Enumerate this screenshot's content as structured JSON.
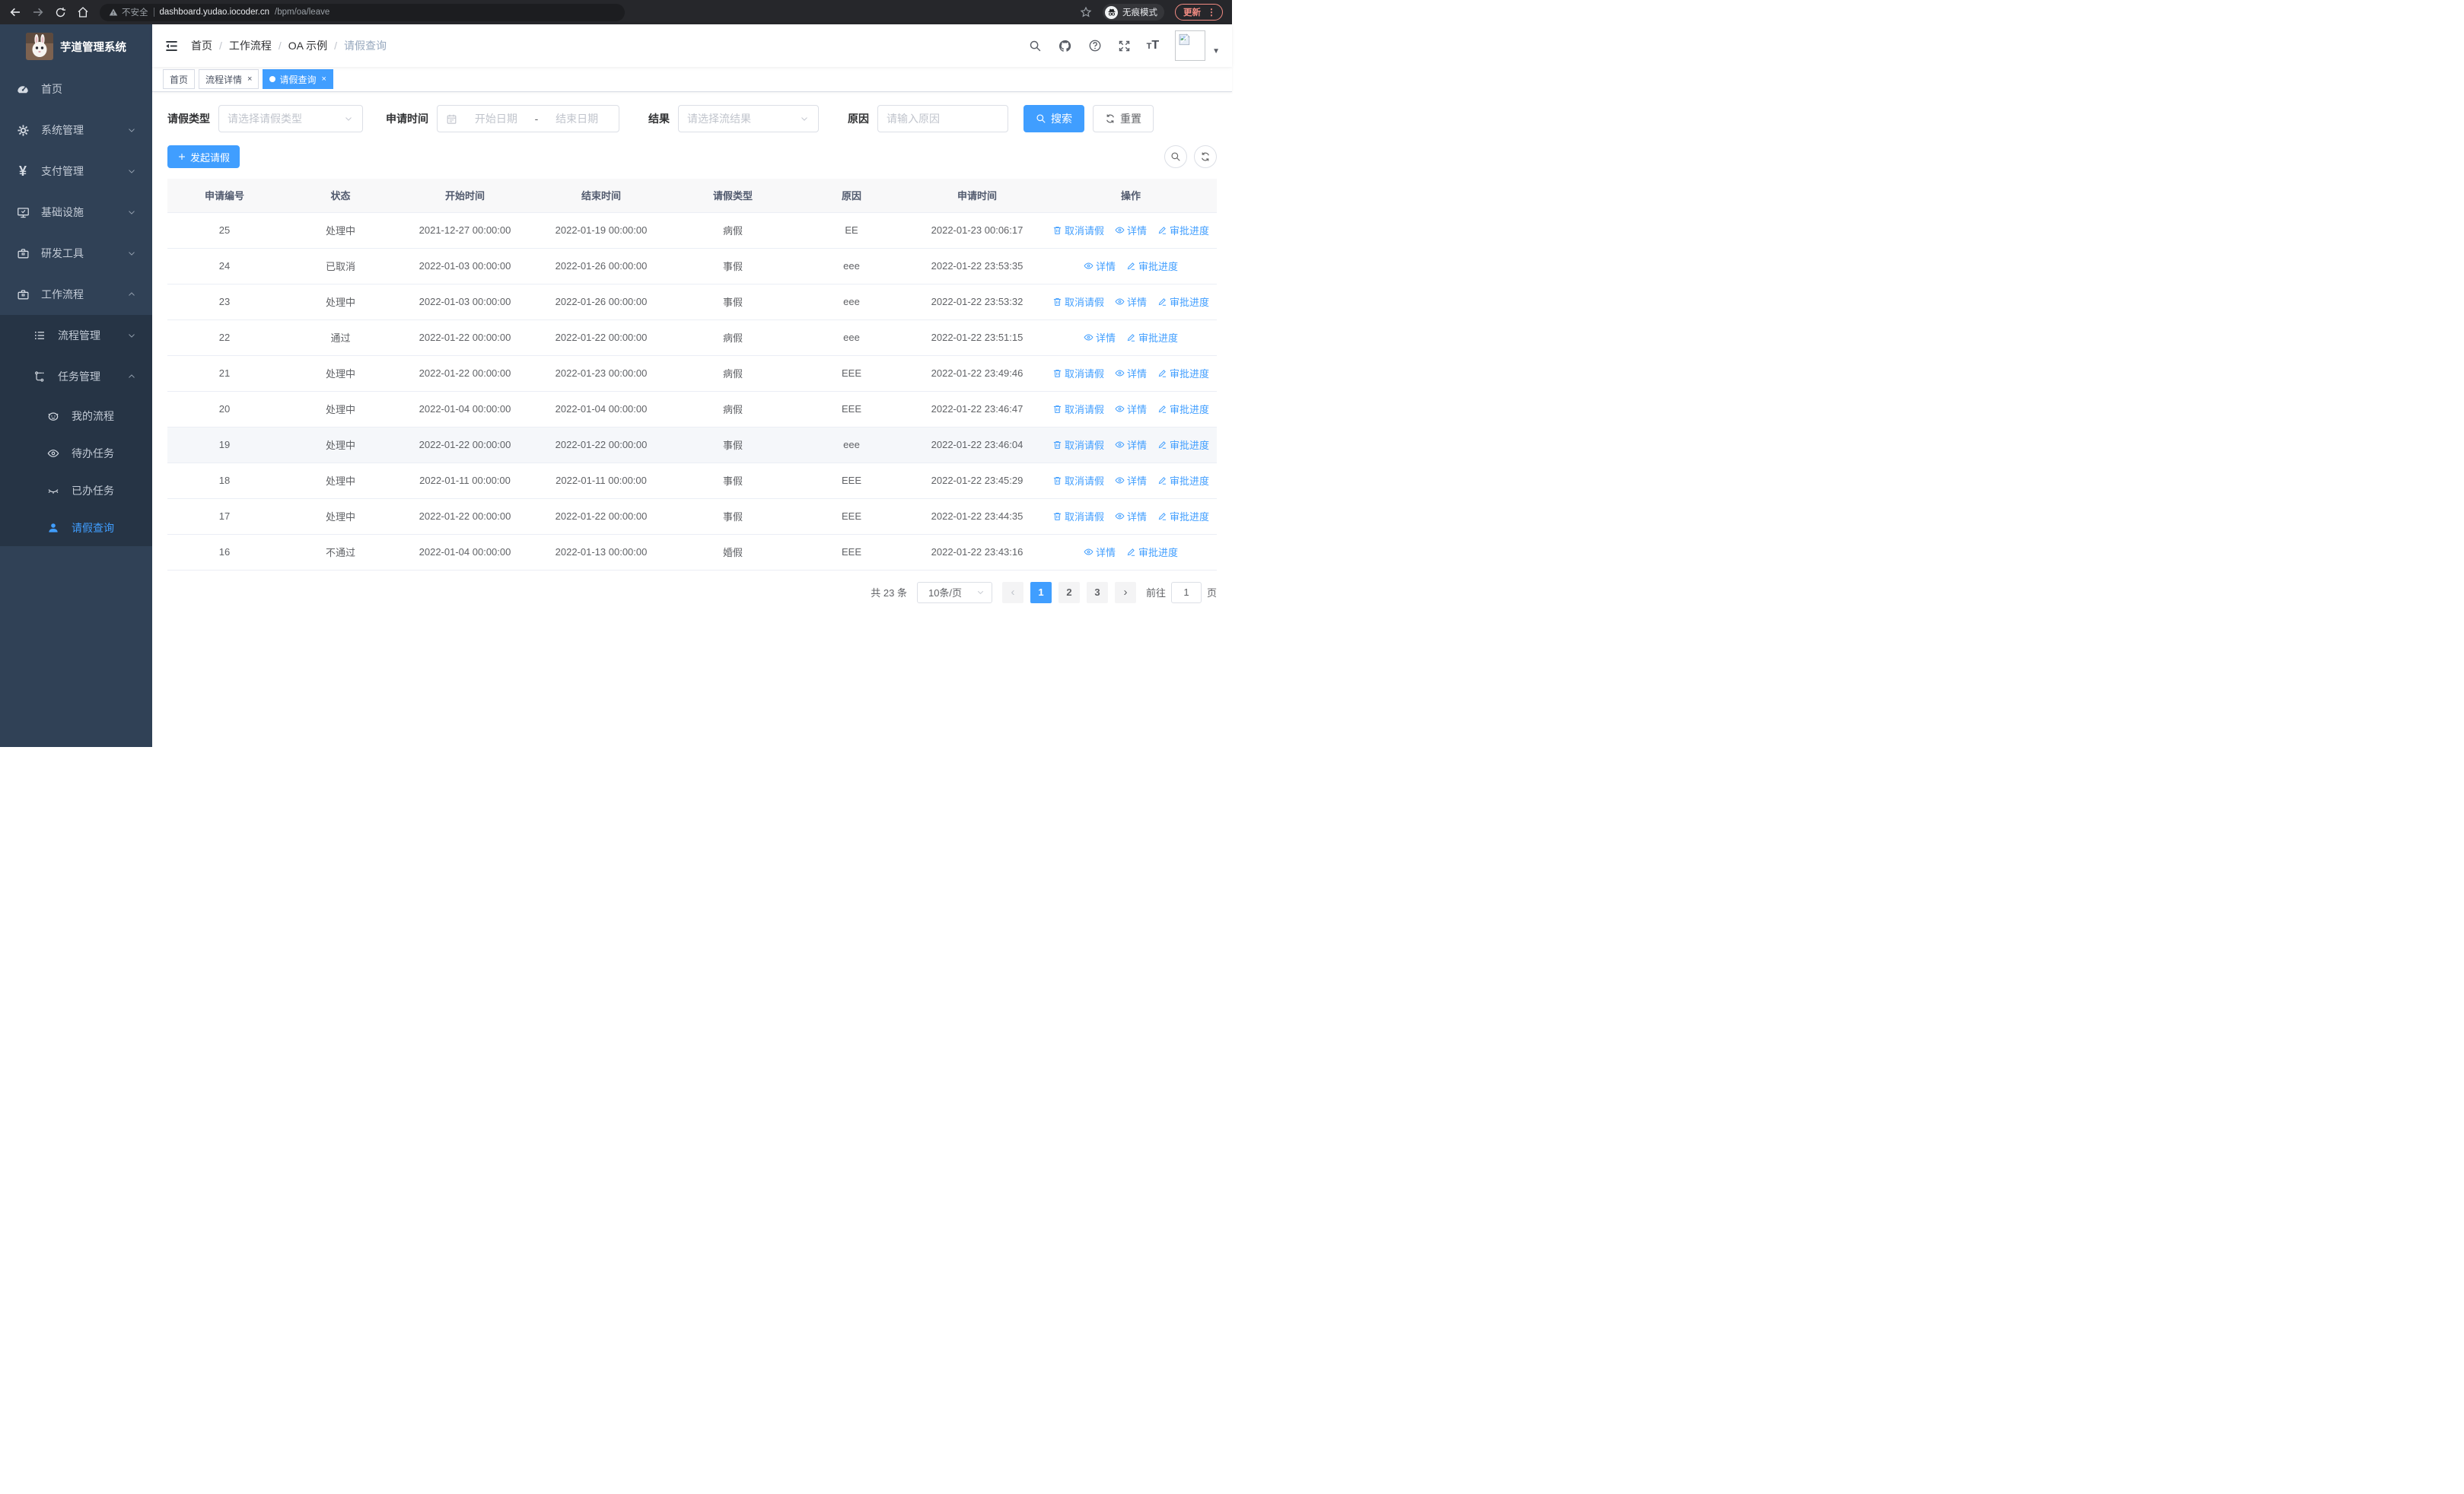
{
  "browser": {
    "security_label": "不安全",
    "url_host": "dashboard.yudao.iocoder.cn",
    "url_path": "/bpm/oa/leave",
    "incognito_label": "无痕模式",
    "update_label": "更新"
  },
  "sidebar": {
    "title": "芋道管理系统",
    "items": [
      {
        "label": "首页"
      },
      {
        "label": "系统管理"
      },
      {
        "label": "支付管理"
      },
      {
        "label": "基础设施"
      },
      {
        "label": "研发工具"
      },
      {
        "label": "工作流程"
      },
      {
        "label": "流程管理"
      },
      {
        "label": "任务管理"
      },
      {
        "label": "我的流程"
      },
      {
        "label": "待办任务"
      },
      {
        "label": "已办任务"
      },
      {
        "label": "请假查询"
      }
    ]
  },
  "breadcrumb": [
    "首页",
    "工作流程",
    "OA 示例",
    "请假查询"
  ],
  "tabs": [
    {
      "label": "首页"
    },
    {
      "label": "流程详情"
    },
    {
      "label": "请假查询"
    }
  ],
  "filters": {
    "leave_type_label": "请假类型",
    "leave_type_placeholder": "请选择请假类型",
    "apply_time_label": "申请时间",
    "date_start_placeholder": "开始日期",
    "date_separator": "-",
    "date_end_placeholder": "结束日期",
    "result_label": "结果",
    "result_placeholder": "请选择流结果",
    "reason_label": "原因",
    "reason_placeholder": "请输入原因",
    "search_label": "搜索",
    "reset_label": "重置"
  },
  "toolbar": {
    "create_label": "发起请假"
  },
  "table": {
    "headers": [
      "申请编号",
      "状态",
      "开始时间",
      "结束时间",
      "请假类型",
      "原因",
      "申请时间",
      "操作"
    ],
    "action_labels": {
      "cancel": "取消请假",
      "detail": "详情",
      "progress": "审批进度"
    },
    "rows": [
      {
        "id": "25",
        "status": "处理中",
        "start": "2021-12-27 00:00:00",
        "end": "2022-01-19 00:00:00",
        "type": "病假",
        "reason": "EE",
        "apply_time": "2022-01-23 00:06:17"
      },
      {
        "id": "24",
        "status": "已取消",
        "start": "2022-01-03 00:00:00",
        "end": "2022-01-26 00:00:00",
        "type": "事假",
        "reason": "eee",
        "apply_time": "2022-01-22 23:53:35"
      },
      {
        "id": "23",
        "status": "处理中",
        "start": "2022-01-03 00:00:00",
        "end": "2022-01-26 00:00:00",
        "type": "事假",
        "reason": "eee",
        "apply_time": "2022-01-22 23:53:32"
      },
      {
        "id": "22",
        "status": "通过",
        "start": "2022-01-22 00:00:00",
        "end": "2022-01-22 00:00:00",
        "type": "病假",
        "reason": "eee",
        "apply_time": "2022-01-22 23:51:15"
      },
      {
        "id": "21",
        "status": "处理中",
        "start": "2022-01-22 00:00:00",
        "end": "2022-01-23 00:00:00",
        "type": "病假",
        "reason": "EEE",
        "apply_time": "2022-01-22 23:49:46"
      },
      {
        "id": "20",
        "status": "处理中",
        "start": "2022-01-04 00:00:00",
        "end": "2022-01-04 00:00:00",
        "type": "病假",
        "reason": "EEE",
        "apply_time": "2022-01-22 23:46:47"
      },
      {
        "id": "19",
        "status": "处理中",
        "start": "2022-01-22 00:00:00",
        "end": "2022-01-22 00:00:00",
        "type": "事假",
        "reason": "eee",
        "apply_time": "2022-01-22 23:46:04"
      },
      {
        "id": "18",
        "status": "处理中",
        "start": "2022-01-11 00:00:00",
        "end": "2022-01-11 00:00:00",
        "type": "事假",
        "reason": "EEE",
        "apply_time": "2022-01-22 23:45:29"
      },
      {
        "id": "17",
        "status": "处理中",
        "start": "2022-01-22 00:00:00",
        "end": "2022-01-22 00:00:00",
        "type": "事假",
        "reason": "EEE",
        "apply_time": "2022-01-22 23:44:35"
      },
      {
        "id": "16",
        "status": "不通过",
        "start": "2022-01-04 00:00:00",
        "end": "2022-01-13 00:00:00",
        "type": "婚假",
        "reason": "EEE",
        "apply_time": "2022-01-22 23:43:16"
      }
    ]
  },
  "pagination": {
    "total": "共 23 条",
    "page_size": "10条/页",
    "prev": "‹",
    "pages": [
      "1",
      "2",
      "3"
    ],
    "next": "›",
    "goto_label": "前往",
    "goto_value": "1",
    "unit": "页"
  },
  "colors": {
    "accent": "#409eff",
    "sidebar_bg": "#304156",
    "submenu_bg": "#263445",
    "update_chip": "#f28b82",
    "row_highlight": "#f5f7fa"
  }
}
